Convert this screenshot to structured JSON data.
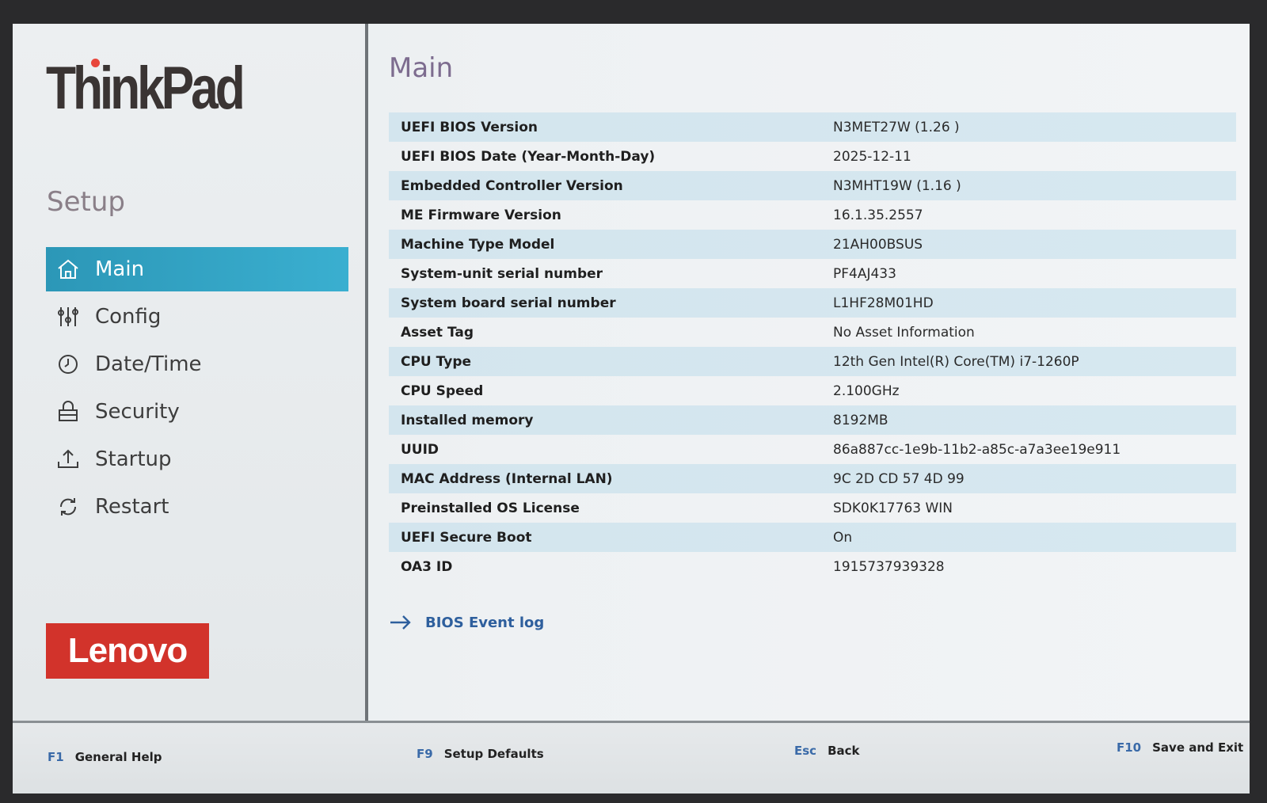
{
  "sidebar": {
    "logo": "ThinkPad",
    "setup_title": "Setup",
    "items": [
      {
        "label": "Main",
        "icon": "home-icon",
        "active": true
      },
      {
        "label": "Config",
        "icon": "sliders-icon",
        "active": false
      },
      {
        "label": "Date/Time",
        "icon": "clock-icon",
        "active": false
      },
      {
        "label": "Security",
        "icon": "lock-icon",
        "active": false
      },
      {
        "label": "Startup",
        "icon": "upload-icon",
        "active": false
      },
      {
        "label": "Restart",
        "icon": "refresh-icon",
        "active": false
      }
    ],
    "brand_logo": "Lenovo"
  },
  "main": {
    "title": "Main",
    "rows": [
      {
        "key": "UEFI BIOS Version",
        "value": "N3MET27W (1.26 )"
      },
      {
        "key": "UEFI BIOS Date (Year-Month-Day)",
        "value": "2025-12-11"
      },
      {
        "key": "Embedded Controller Version",
        "value": "N3MHT19W (1.16 )"
      },
      {
        "key": "ME Firmware Version",
        "value": "16.1.35.2557"
      },
      {
        "key": "Machine Type Model",
        "value": "21AH00BSUS"
      },
      {
        "key": "System-unit serial number",
        "value": "PF4AJ433"
      },
      {
        "key": "System board serial number",
        "value": "L1HF28M01HD"
      },
      {
        "key": "Asset Tag",
        "value": "No Asset Information"
      },
      {
        "key": "CPU Type",
        "value": "12th Gen Intel(R) Core(TM) i7-1260P"
      },
      {
        "key": "CPU Speed",
        "value": "2.100GHz"
      },
      {
        "key": "Installed memory",
        "value": "8192MB"
      },
      {
        "key": "UUID",
        "value": "86a887cc-1e9b-11b2-a85c-a7a3ee19e911"
      },
      {
        "key": "MAC Address (Internal LAN)",
        "value": "9C 2D CD 57 4D 99"
      },
      {
        "key": "Preinstalled OS License",
        "value": "SDK0K17763 WIN"
      },
      {
        "key": "UEFI Secure Boot",
        "value": "On"
      },
      {
        "key": "OA3 ID",
        "value": "1915737939328"
      }
    ],
    "event_log_label": "BIOS Event log"
  },
  "footer": {
    "keys": [
      {
        "key": "F1",
        "action": "General Help"
      },
      {
        "key": "F9",
        "action": "Setup Defaults"
      },
      {
        "key": "Esc",
        "action": "Back"
      },
      {
        "key": "F10",
        "action": "Save and Exit"
      }
    ]
  },
  "colors": {
    "accent": "#2c97b7",
    "row_stripe": "#d3e5ee",
    "title": "#7d6c8f",
    "lenovo_red": "#d2332b",
    "key_blue": "#3a6aa8"
  }
}
